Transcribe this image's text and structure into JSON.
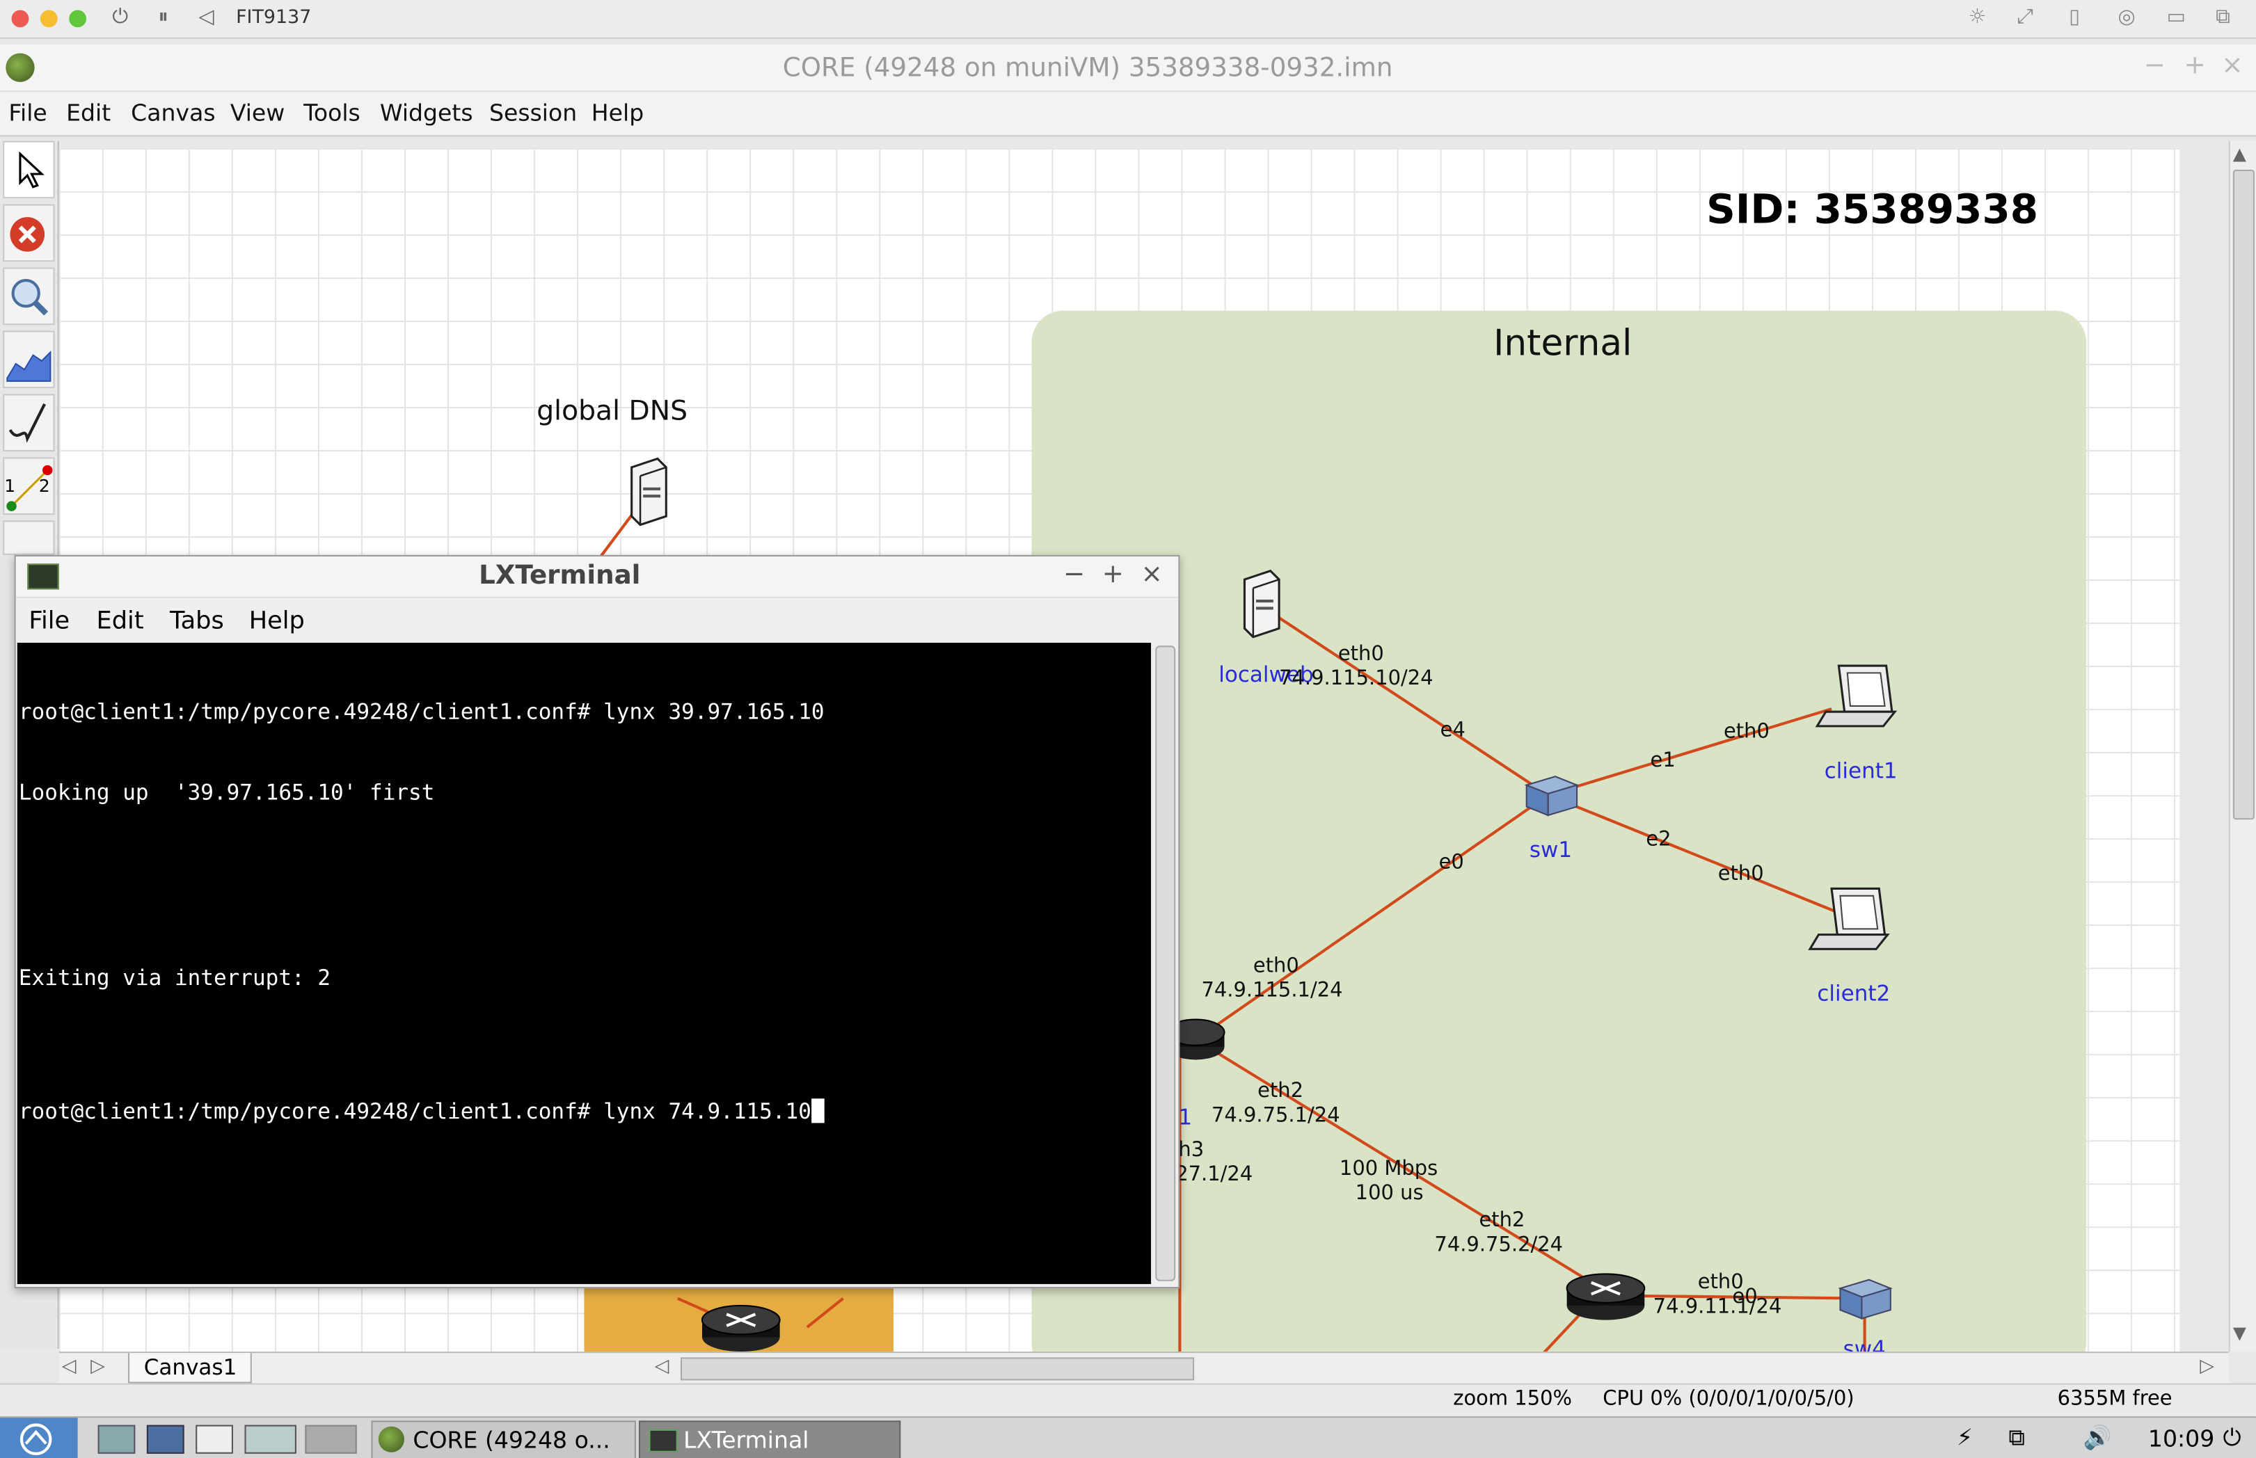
{
  "host": {
    "title": "FIT9137"
  },
  "core_window": {
    "title": "CORE (49248 on muniVM) 35389338-0932.imn"
  },
  "menubar": {
    "items": [
      "File",
      "Edit",
      "Canvas",
      "View",
      "Tools",
      "Widgets",
      "Session",
      "Help"
    ]
  },
  "toolbar": {
    "tools": [
      "select-tool",
      "stop-tool",
      "zoom-tool",
      "graph-tool",
      "draw-tool",
      "two-node-tool",
      "run-tool"
    ],
    "link_numbers": [
      "1",
      "2"
    ]
  },
  "canvas": {
    "sid": "SID: 35389338",
    "region_label": "Internal",
    "region_color": "#d9e3c6",
    "orange_region_color": "#e5ac42",
    "link_color": "#d24a1c",
    "dns_label": "global DNS",
    "nodes": {
      "localweb": "localweb",
      "sw1": "sw1",
      "client1": "client1",
      "client2": "client2",
      "sw4": "sw4",
      "router_partial": "1"
    },
    "interface_labels": {
      "localweb_eth0": "eth0",
      "localweb_ip": "74.9.115.10/24",
      "sw1_e4": "e4",
      "sw1_e1": "e1",
      "client1_eth0": "eth0",
      "sw1_e2": "e2",
      "client2_eth0": "eth0",
      "sw1_e0": "e0",
      "router_eth0": "eth0",
      "router_eth0_ip": "74.9.115.1/24",
      "router_eth2": "eth2",
      "router_eth2_ip": "74.9.75.1/24",
      "router_eth3": "h3",
      "router_eth3_ip": "27.1/24",
      "link_bw": "100 Mbps",
      "link_delay": "100 us",
      "r2_eth2": "eth2",
      "r2_eth2_ip": "74.9.75.2/24",
      "r2_eth0": "eth0",
      "r2_eth0_ip": "74.9.11.1/24",
      "sw4_e0": "e0"
    },
    "tab": "Canvas1"
  },
  "terminal": {
    "title": "LXTerminal",
    "menu": [
      "File",
      "Edit",
      "Tabs",
      "Help"
    ],
    "lines": [
      "root@client1:/tmp/pycore.49248/client1.conf# lynx 39.97.165.10",
      "Looking up  '39.97.165.10' first",
      "",
      "",
      "Exiting via interrupt: 2",
      "",
      "root@client1:/tmp/pycore.49248/client1.conf# lynx 74.9.115.10"
    ]
  },
  "status": {
    "zoom": "zoom 150%",
    "cpu": "CPU 0% (0/0/0/1/0/0/5/0)",
    "mem": "6355M free"
  },
  "taskbar": {
    "apps": [
      "CORE (49248 o...",
      "LXTerminal"
    ],
    "clock": "10:09"
  }
}
